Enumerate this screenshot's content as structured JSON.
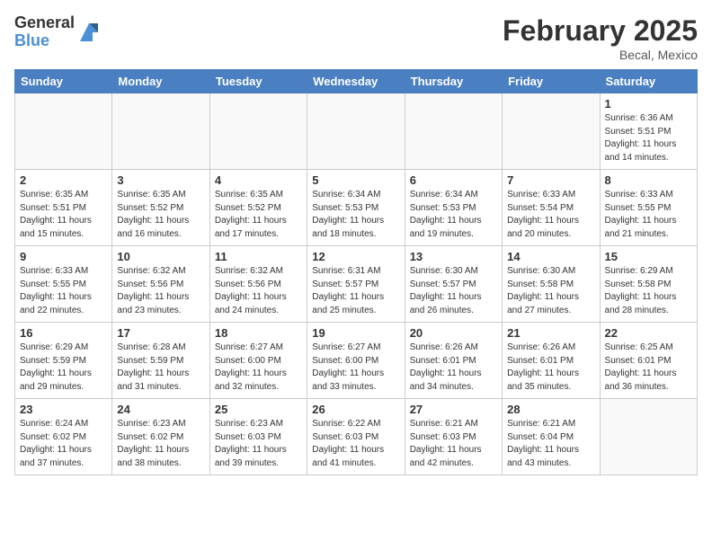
{
  "logo": {
    "general": "General",
    "blue": "Blue"
  },
  "title": "February 2025",
  "location": "Becal, Mexico",
  "days_of_week": [
    "Sunday",
    "Monday",
    "Tuesday",
    "Wednesday",
    "Thursday",
    "Friday",
    "Saturday"
  ],
  "weeks": [
    [
      {
        "day": "",
        "info": ""
      },
      {
        "day": "",
        "info": ""
      },
      {
        "day": "",
        "info": ""
      },
      {
        "day": "",
        "info": ""
      },
      {
        "day": "",
        "info": ""
      },
      {
        "day": "",
        "info": ""
      },
      {
        "day": "1",
        "info": "Sunrise: 6:36 AM\nSunset: 5:51 PM\nDaylight: 11 hours\nand 14 minutes."
      }
    ],
    [
      {
        "day": "2",
        "info": "Sunrise: 6:35 AM\nSunset: 5:51 PM\nDaylight: 11 hours\nand 15 minutes."
      },
      {
        "day": "3",
        "info": "Sunrise: 6:35 AM\nSunset: 5:52 PM\nDaylight: 11 hours\nand 16 minutes."
      },
      {
        "day": "4",
        "info": "Sunrise: 6:35 AM\nSunset: 5:52 PM\nDaylight: 11 hours\nand 17 minutes."
      },
      {
        "day": "5",
        "info": "Sunrise: 6:34 AM\nSunset: 5:53 PM\nDaylight: 11 hours\nand 18 minutes."
      },
      {
        "day": "6",
        "info": "Sunrise: 6:34 AM\nSunset: 5:53 PM\nDaylight: 11 hours\nand 19 minutes."
      },
      {
        "day": "7",
        "info": "Sunrise: 6:33 AM\nSunset: 5:54 PM\nDaylight: 11 hours\nand 20 minutes."
      },
      {
        "day": "8",
        "info": "Sunrise: 6:33 AM\nSunset: 5:55 PM\nDaylight: 11 hours\nand 21 minutes."
      }
    ],
    [
      {
        "day": "9",
        "info": "Sunrise: 6:33 AM\nSunset: 5:55 PM\nDaylight: 11 hours\nand 22 minutes."
      },
      {
        "day": "10",
        "info": "Sunrise: 6:32 AM\nSunset: 5:56 PM\nDaylight: 11 hours\nand 23 minutes."
      },
      {
        "day": "11",
        "info": "Sunrise: 6:32 AM\nSunset: 5:56 PM\nDaylight: 11 hours\nand 24 minutes."
      },
      {
        "day": "12",
        "info": "Sunrise: 6:31 AM\nSunset: 5:57 PM\nDaylight: 11 hours\nand 25 minutes."
      },
      {
        "day": "13",
        "info": "Sunrise: 6:30 AM\nSunset: 5:57 PM\nDaylight: 11 hours\nand 26 minutes."
      },
      {
        "day": "14",
        "info": "Sunrise: 6:30 AM\nSunset: 5:58 PM\nDaylight: 11 hours\nand 27 minutes."
      },
      {
        "day": "15",
        "info": "Sunrise: 6:29 AM\nSunset: 5:58 PM\nDaylight: 11 hours\nand 28 minutes."
      }
    ],
    [
      {
        "day": "16",
        "info": "Sunrise: 6:29 AM\nSunset: 5:59 PM\nDaylight: 11 hours\nand 29 minutes."
      },
      {
        "day": "17",
        "info": "Sunrise: 6:28 AM\nSunset: 5:59 PM\nDaylight: 11 hours\nand 31 minutes."
      },
      {
        "day": "18",
        "info": "Sunrise: 6:27 AM\nSunset: 6:00 PM\nDaylight: 11 hours\nand 32 minutes."
      },
      {
        "day": "19",
        "info": "Sunrise: 6:27 AM\nSunset: 6:00 PM\nDaylight: 11 hours\nand 33 minutes."
      },
      {
        "day": "20",
        "info": "Sunrise: 6:26 AM\nSunset: 6:01 PM\nDaylight: 11 hours\nand 34 minutes."
      },
      {
        "day": "21",
        "info": "Sunrise: 6:26 AM\nSunset: 6:01 PM\nDaylight: 11 hours\nand 35 minutes."
      },
      {
        "day": "22",
        "info": "Sunrise: 6:25 AM\nSunset: 6:01 PM\nDaylight: 11 hours\nand 36 minutes."
      }
    ],
    [
      {
        "day": "23",
        "info": "Sunrise: 6:24 AM\nSunset: 6:02 PM\nDaylight: 11 hours\nand 37 minutes."
      },
      {
        "day": "24",
        "info": "Sunrise: 6:23 AM\nSunset: 6:02 PM\nDaylight: 11 hours\nand 38 minutes."
      },
      {
        "day": "25",
        "info": "Sunrise: 6:23 AM\nSunset: 6:03 PM\nDaylight: 11 hours\nand 39 minutes."
      },
      {
        "day": "26",
        "info": "Sunrise: 6:22 AM\nSunset: 6:03 PM\nDaylight: 11 hours\nand 41 minutes."
      },
      {
        "day": "27",
        "info": "Sunrise: 6:21 AM\nSunset: 6:03 PM\nDaylight: 11 hours\nand 42 minutes."
      },
      {
        "day": "28",
        "info": "Sunrise: 6:21 AM\nSunset: 6:04 PM\nDaylight: 11 hours\nand 43 minutes."
      },
      {
        "day": "",
        "info": ""
      }
    ]
  ]
}
